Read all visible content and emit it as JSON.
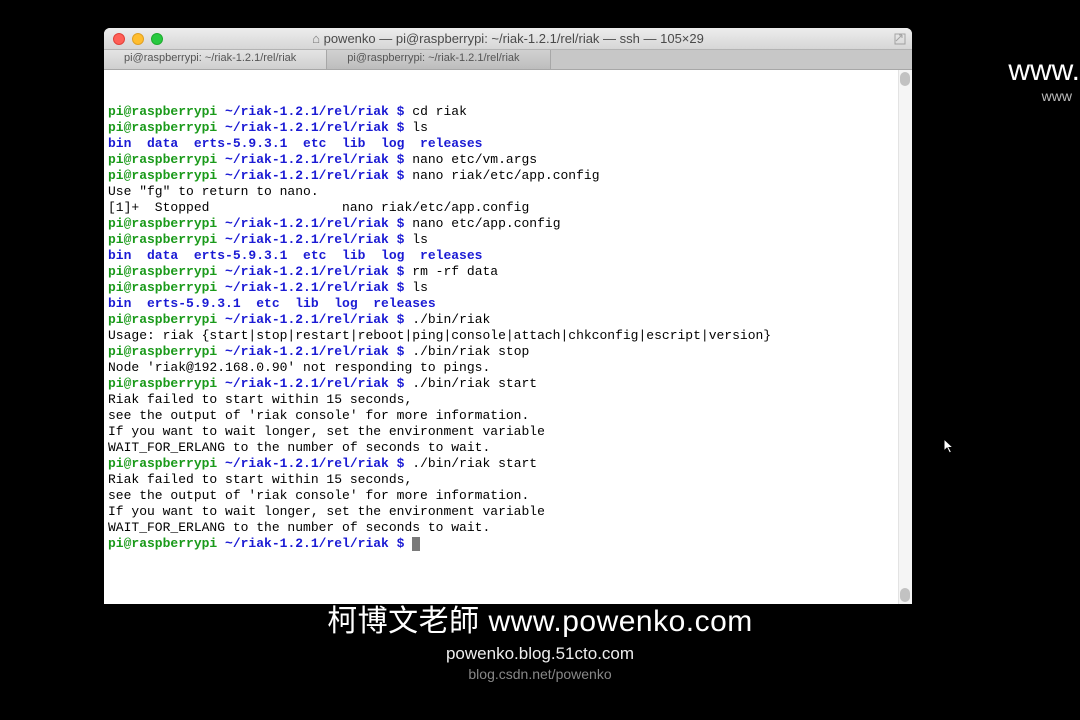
{
  "window": {
    "title": "powenko — pi@raspberrypi: ~/riak-1.2.1/rel/riak — ssh — 105×29"
  },
  "tabs": [
    {
      "label": "pi@raspberrypi: ~/riak-1.2.1/rel/riak"
    },
    {
      "label": "pi@raspberrypi: ~/riak-1.2.1/rel/riak"
    }
  ],
  "prompt": {
    "user": "pi@raspberrypi",
    "path": "~/riak-1.2.1/rel/riak",
    "dollar": "$ "
  },
  "lines": [
    {
      "type": "prompt",
      "cmd": "cd riak"
    },
    {
      "type": "prompt",
      "cmd": "ls"
    },
    {
      "type": "blue",
      "text": "bin  data  erts-5.9.3.1  etc  lib  log  releases"
    },
    {
      "type": "prompt",
      "cmd": "nano etc/vm.args"
    },
    {
      "type": "prompt",
      "cmd": "nano riak/etc/app.config"
    },
    {
      "type": "out",
      "text": "Use \"fg\" to return to nano."
    },
    {
      "type": "out",
      "text": ""
    },
    {
      "type": "out",
      "text": "[1]+  Stopped                 nano riak/etc/app.config"
    },
    {
      "type": "prompt",
      "cmd": "nano etc/app.config"
    },
    {
      "type": "prompt",
      "cmd": "ls"
    },
    {
      "type": "blue",
      "text": "bin  data  erts-5.9.3.1  etc  lib  log  releases"
    },
    {
      "type": "prompt",
      "cmd": "rm -rf data"
    },
    {
      "type": "prompt",
      "cmd": "ls"
    },
    {
      "type": "blue",
      "text": "bin  erts-5.9.3.1  etc  lib  log  releases"
    },
    {
      "type": "prompt",
      "cmd": "./bin/riak"
    },
    {
      "type": "out",
      "text": "Usage: riak {start|stop|restart|reboot|ping|console|attach|chkconfig|escript|version}"
    },
    {
      "type": "prompt",
      "cmd": "./bin/riak stop"
    },
    {
      "type": "out",
      "text": "Node 'riak@192.168.0.90' not responding to pings."
    },
    {
      "type": "prompt",
      "cmd": "./bin/riak start"
    },
    {
      "type": "out",
      "text": "Riak failed to start within 15 seconds,"
    },
    {
      "type": "out",
      "text": "see the output of 'riak console' for more information."
    },
    {
      "type": "out",
      "text": "If you want to wait longer, set the environment variable"
    },
    {
      "type": "out",
      "text": "WAIT_FOR_ERLANG to the number of seconds to wait."
    },
    {
      "type": "prompt",
      "cmd": "./bin/riak start"
    },
    {
      "type": "out",
      "text": "Riak failed to start within 15 seconds,"
    },
    {
      "type": "out",
      "text": "see the output of 'riak console' for more information."
    },
    {
      "type": "out",
      "text": "If you want to wait longer, set the environment variable"
    },
    {
      "type": "out",
      "text": "WAIT_FOR_ERLANG to the number of seconds to wait."
    },
    {
      "type": "prompt",
      "cmd": "",
      "cursor": true
    }
  ],
  "bgright": {
    "l1": "www.",
    "l2": "www"
  },
  "footer": {
    "l1": "柯博文老師 www.powenko.com",
    "l2": "powenko.blog.51cto.com",
    "l3": "blog.csdn.net/powenko"
  }
}
